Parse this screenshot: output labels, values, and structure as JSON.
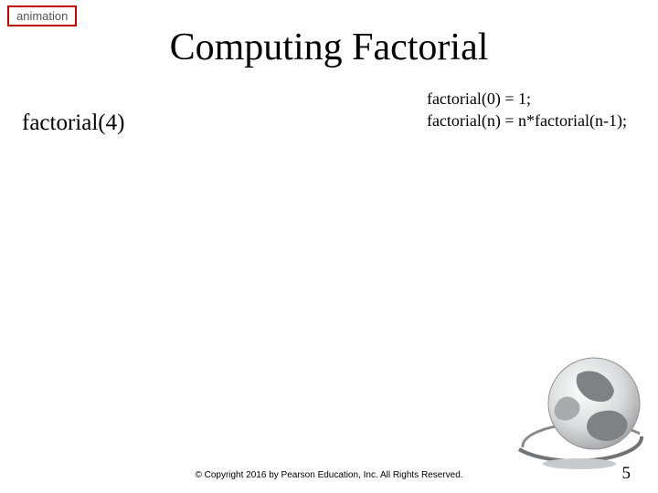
{
  "tag": {
    "label": "animation"
  },
  "title": "Computing Factorial",
  "left": {
    "expr": "factorial(4)"
  },
  "defs": {
    "line1": "factorial(0) = 1;",
    "line2": "factorial(n) = n*factorial(n-1);"
  },
  "footer": "© Copyright 2016 by Pearson Education, Inc. All Rights Reserved.",
  "page_number": "5"
}
